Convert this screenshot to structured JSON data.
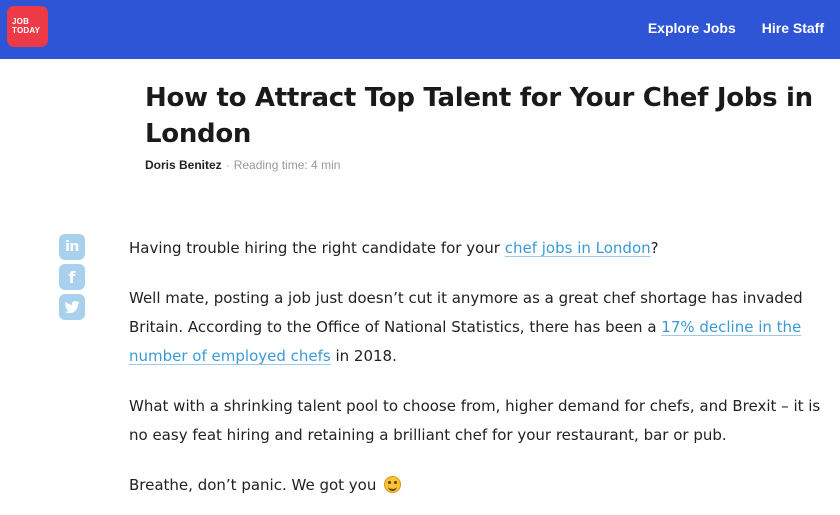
{
  "header": {
    "logo_line1": "JOB",
    "logo_line2": "TODAY",
    "nav": [
      "Explore Jobs",
      "Hire Staff"
    ],
    "brand_color": "#2d55d6",
    "logo_color": "#ee3a46"
  },
  "article": {
    "title": "How to Attract Top Talent for Your Chef Jobs in London",
    "author": "Doris Benitez",
    "separator": "·",
    "reading_time": "Reading time: 4 min",
    "share_icons": [
      "linkedin-icon",
      "facebook-icon",
      "twitter-icon"
    ],
    "p1_text": "Having trouble hiring the right candidate for your ",
    "p1_link": "chef jobs in London",
    "p1_end": "?",
    "p2_text": "Well mate, posting a job just doesn’t cut it anymore as a great chef shortage has invaded Britain. According to the Office of National Statistics, there has been a ",
    "p2_link": "17% decline in the number of employed chefs",
    "p2_end": " in 2018.",
    "p3_text": "What with a shrinking talent pool to choose from, higher demand for chefs, and Brexit – it is no easy feat hiring and retaining a brilliant chef for your restaurant, bar or pub.",
    "p4_text": "Breathe, don’t panic. We got you",
    "p4_emoji": "smiling-face-emoji",
    "link_color": "#3a9ad9"
  }
}
